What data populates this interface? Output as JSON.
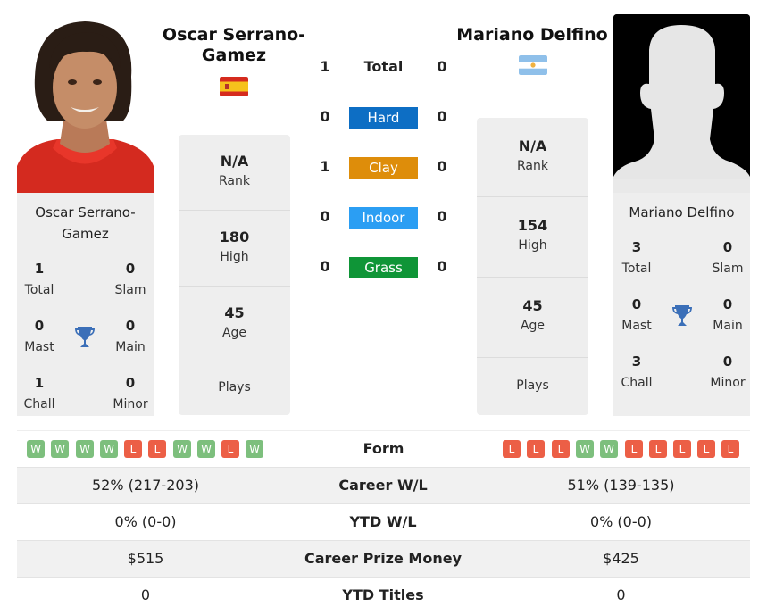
{
  "player1": {
    "name": "Oscar Serrano-Gamez",
    "name_line1": "Oscar Serrano-",
    "name_line2": "Gamez",
    "country_flag": "spain-flag",
    "rank": {
      "value": "N/A",
      "label": "Rank"
    },
    "high": {
      "value": "180",
      "label": "High"
    },
    "age": {
      "value": "45",
      "label": "Age"
    },
    "plays": {
      "value": "",
      "label": "Plays"
    },
    "titles": {
      "total": {
        "value": "1",
        "label": "Total"
      },
      "slam": {
        "value": "0",
        "label": "Slam"
      },
      "mast": {
        "value": "0",
        "label": "Mast"
      },
      "main": {
        "value": "0",
        "label": "Main"
      },
      "chall": {
        "value": "1",
        "label": "Chall"
      },
      "minor": {
        "value": "0",
        "label": "Minor"
      }
    },
    "form": [
      "W",
      "W",
      "W",
      "W",
      "L",
      "L",
      "W",
      "W",
      "L",
      "W"
    ]
  },
  "player2": {
    "name": "Mariano Delfino",
    "country_flag": "argentina-flag",
    "rank": {
      "value": "N/A",
      "label": "Rank"
    },
    "high": {
      "value": "154",
      "label": "High"
    },
    "age": {
      "value": "45",
      "label": "Age"
    },
    "plays": {
      "value": "",
      "label": "Plays"
    },
    "titles": {
      "total": {
        "value": "3",
        "label": "Total"
      },
      "slam": {
        "value": "0",
        "label": "Slam"
      },
      "mast": {
        "value": "0",
        "label": "Mast"
      },
      "main": {
        "value": "0",
        "label": "Main"
      },
      "chall": {
        "value": "3",
        "label": "Chall"
      },
      "minor": {
        "value": "0",
        "label": "Minor"
      }
    },
    "form": [
      "L",
      "L",
      "L",
      "W",
      "W",
      "L",
      "L",
      "L",
      "L",
      "L"
    ]
  },
  "h2h": {
    "total": {
      "label": "Total",
      "p1": "1",
      "p2": "0"
    },
    "surfaces": [
      {
        "label": "Hard",
        "p1": "0",
        "p2": "0",
        "color": "#0d6ec4"
      },
      {
        "label": "Clay",
        "p1": "1",
        "p2": "0",
        "color": "#de8d0a"
      },
      {
        "label": "Indoor",
        "p1": "0",
        "p2": "0",
        "color": "#2b9ef3"
      },
      {
        "label": "Grass",
        "p1": "0",
        "p2": "0",
        "color": "#0f9537"
      }
    ]
  },
  "form_label": "Form",
  "stats": [
    {
      "label": "Career W/L",
      "p1": "52% (217-203)",
      "p2": "51% (139-135)"
    },
    {
      "label": "YTD W/L",
      "p1": "0% (0-0)",
      "p2": "0% (0-0)"
    },
    {
      "label": "Career Prize Money",
      "p1": "$515",
      "p2": "$425"
    },
    {
      "label": "YTD Titles",
      "p1": "0",
      "p2": "0"
    }
  ],
  "colors": {
    "win": "#7dbf7d",
    "loss": "#ec5f46",
    "trophy": "#3b6fb8",
    "card_bg": "#eeeeee"
  }
}
